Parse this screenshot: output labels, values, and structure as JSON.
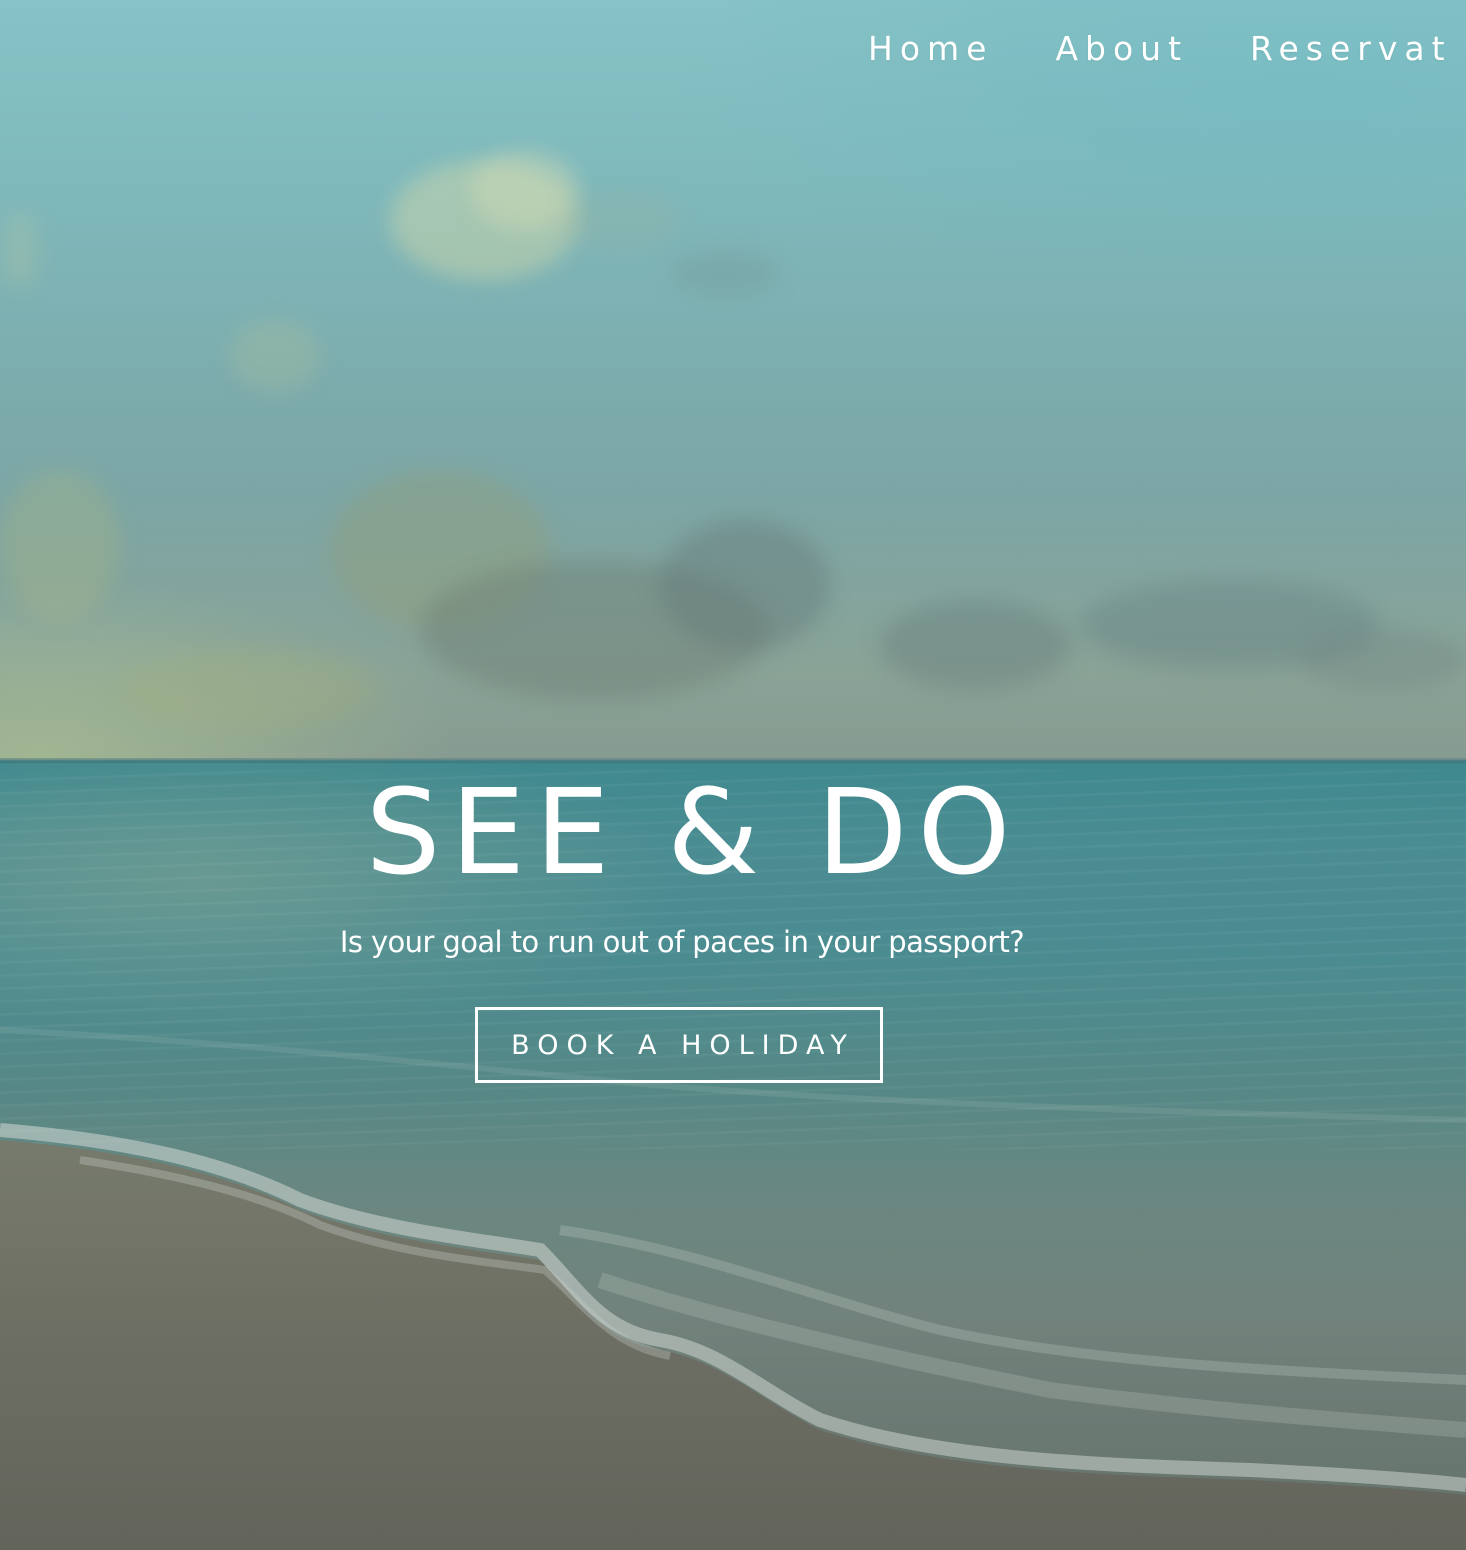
{
  "nav": {
    "items": [
      {
        "label": "Home"
      },
      {
        "label": "About"
      },
      {
        "label": "Reservat"
      }
    ]
  },
  "hero": {
    "title": "SEE & DO",
    "subtitle": "Is your goal to run out of paces in your passport?",
    "cta_label": "BOOK A HOLIDAY"
  },
  "colors": {
    "text": "#ffffff",
    "sky": "#82bbbf",
    "sea": "#4e9196",
    "sand": "#7b7b6c"
  }
}
